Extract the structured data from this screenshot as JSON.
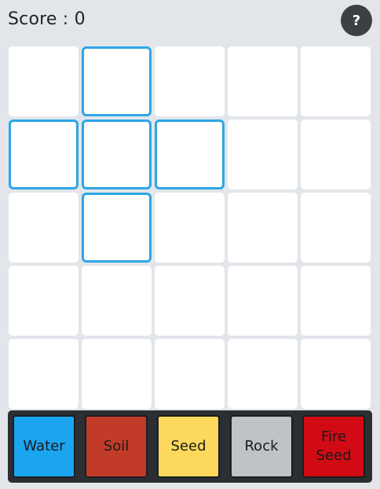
{
  "header": {
    "score_text": "Score : 0",
    "help_label": "?"
  },
  "board": {
    "rows": 5,
    "cols": 5,
    "highlighted_cells": [
      [
        0,
        1
      ],
      [
        1,
        0
      ],
      [
        1,
        1
      ],
      [
        1,
        2
      ],
      [
        2,
        1
      ]
    ],
    "highlight_color": "#2ea6e6"
  },
  "palette": {
    "items": [
      {
        "label": "Water",
        "color": "#1ba5ee"
      },
      {
        "label": "Soil",
        "color": "#c23b28"
      },
      {
        "label": "Seed",
        "color": "#fcd95c"
      },
      {
        "label": "Rock",
        "color": "#bfc2c6"
      },
      {
        "label": "Fire\nSeed",
        "color": "#d00b14"
      }
    ]
  }
}
